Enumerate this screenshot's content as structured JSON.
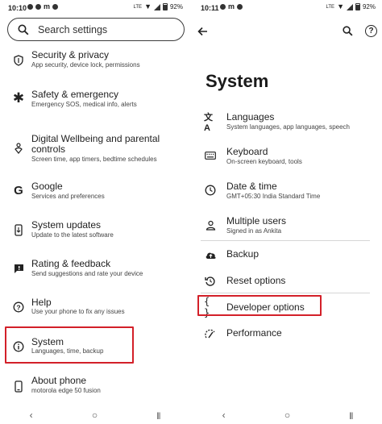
{
  "left": {
    "status": {
      "time": "10:10",
      "battery": "92%",
      "network": "LTE"
    },
    "search_placeholder": "Search settings",
    "items": [
      {
        "title": "Security & privacy",
        "sub": "App security, device lock, permissions",
        "icon": "shield-icon"
      },
      {
        "title": "Safety & emergency",
        "sub": "Emergency SOS, medical info, alerts",
        "icon": "asterisk-icon"
      },
      {
        "title": "Digital Wellbeing and parental",
        "title2": "controls",
        "sub": "Screen time, app timers, bedtime schedules",
        "icon": "wellbeing-icon"
      },
      {
        "title": "Google",
        "sub": "Services and preferences",
        "icon": "google-icon"
      },
      {
        "title": "System updates",
        "sub": "Update to the latest software",
        "icon": "phone-update-icon"
      },
      {
        "title": "Rating & feedback",
        "sub": "Send suggestions and rate your device",
        "icon": "feedback-icon"
      },
      {
        "title": "Help",
        "sub": "Use your phone to fix any issues",
        "icon": "help-icon"
      },
      {
        "title": "System",
        "sub": "Languages, time, backup",
        "icon": "info-icon"
      },
      {
        "title": "About phone",
        "sub": "motorola edge 50 fusion",
        "icon": "phone-icon"
      }
    ]
  },
  "right": {
    "status": {
      "time": "10:11",
      "battery": "92%",
      "network": "LTE"
    },
    "page_title": "System",
    "items": [
      {
        "title": "Languages",
        "sub": "System languages, app languages, speech",
        "icon": "translate-icon"
      },
      {
        "title": "Keyboard",
        "sub": "On-screen keyboard, tools",
        "icon": "keyboard-icon"
      },
      {
        "title": "Date & time",
        "sub": "GMT+05:30 India Standard Time",
        "icon": "clock-icon"
      },
      {
        "title": "Multiple users",
        "sub": "Signed in as Ankita",
        "icon": "user-icon"
      },
      {
        "title": "Backup",
        "sub": "",
        "icon": "cloud-upload-icon"
      },
      {
        "title": "Reset options",
        "sub": "",
        "icon": "reset-icon"
      },
      {
        "title": "Developer options",
        "sub": "",
        "icon": "braces-icon"
      },
      {
        "title": "Performance",
        "sub": "",
        "icon": "performance-icon"
      }
    ]
  },
  "colors": {
    "highlight": "#d32029",
    "text": "#1f1f1f",
    "subtext": "#444444"
  }
}
